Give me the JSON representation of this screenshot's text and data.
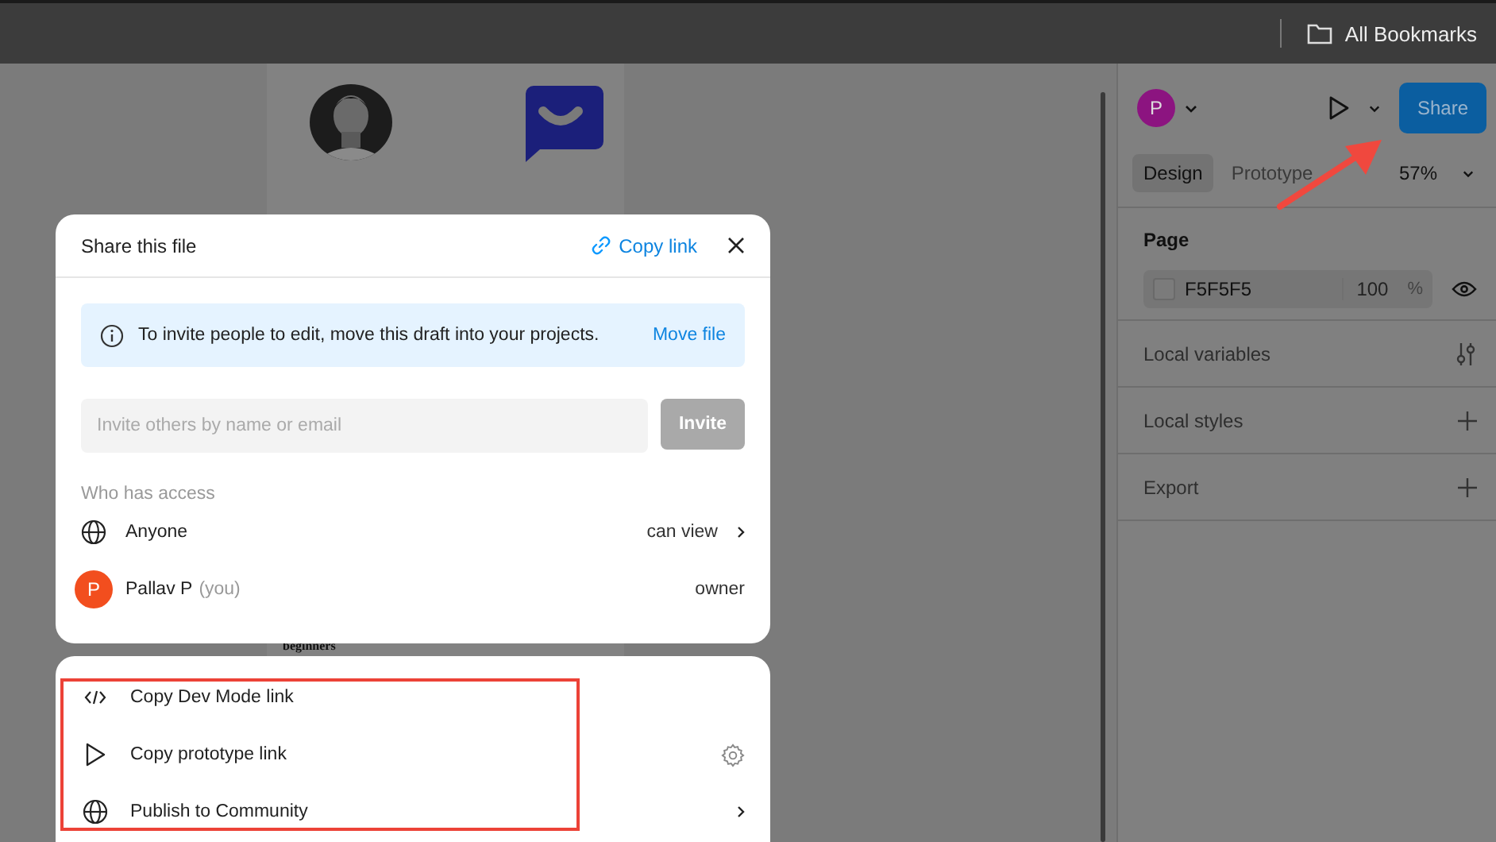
{
  "top_bar": {
    "bookmarks": "All Bookmarks"
  },
  "canvas": {
    "caption": "beginners"
  },
  "right_panel": {
    "avatar_initial": "P",
    "share_button": "Share",
    "tabs": [
      {
        "label": "Design",
        "selected": true
      },
      {
        "label": "Prototype",
        "selected": false
      }
    ],
    "zoom": "57%",
    "page": {
      "title": "Page",
      "color_hex": "F5F5F5",
      "opacity": "100",
      "percent": "%"
    },
    "sections": [
      {
        "label": "Local variables",
        "kind": "variables"
      },
      {
        "label": "Local styles",
        "kind": "add"
      },
      {
        "label": "Export",
        "kind": "add"
      }
    ]
  },
  "share_dialog": {
    "title": "Share this file",
    "copy_link": "Copy link",
    "notice": {
      "text": "To invite people to edit, move this draft into your projects.",
      "action": "Move file"
    },
    "invite": {
      "placeholder": "Invite others by name or email",
      "button": "Invite",
      "disabled": true
    },
    "access_heading": "Who has access",
    "access": [
      {
        "kind": "public",
        "name": "Anyone",
        "role": "can view"
      },
      {
        "kind": "user",
        "initial": "P",
        "name": "Pallav P",
        "note": "(you)",
        "role": "owner"
      }
    ]
  },
  "link_menu": {
    "items": [
      {
        "kind": "code",
        "label": "Copy Dev Mode link"
      },
      {
        "kind": "play",
        "label": "Copy prototype link",
        "has_settings": true,
        "has_submenu": false
      },
      {
        "kind": "globe",
        "label": "Publish to Community",
        "has_settings": false,
        "has_submenu": true
      }
    ]
  }
}
